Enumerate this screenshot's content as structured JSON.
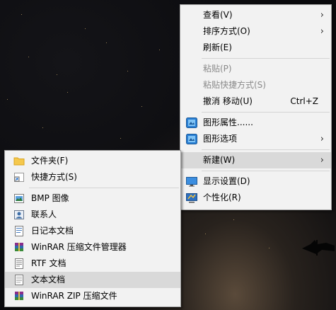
{
  "context_menu": {
    "items": [
      {
        "label": "查看(V)",
        "submenu": true
      },
      {
        "label": "排序方式(O)",
        "submenu": true
      },
      {
        "label": "刷新(E)"
      },
      {
        "label": "粘贴(P)",
        "disabled": true
      },
      {
        "label": "粘贴快捷方式(S)",
        "disabled": true
      },
      {
        "label": "撤消 移动(U)",
        "shortcut": "Ctrl+Z"
      },
      {
        "label": "图形属性......",
        "icon": "graphics-icon"
      },
      {
        "label": "图形选项",
        "icon": "graphics-icon",
        "submenu": true
      },
      {
        "label": "新建(W)",
        "submenu": true,
        "highlighted": true
      },
      {
        "label": "显示设置(D)",
        "icon": "display-icon"
      },
      {
        "label": "个性化(R)",
        "icon": "personalize-icon"
      }
    ]
  },
  "new_submenu": {
    "items": [
      {
        "label": "文件夹(F)",
        "icon": "folder-icon"
      },
      {
        "label": "快捷方式(S)",
        "icon": "shortcut-icon"
      },
      {
        "label": "BMP 图像",
        "icon": "bmp-icon"
      },
      {
        "label": "联系人",
        "icon": "contact-icon"
      },
      {
        "label": "日记本文档",
        "icon": "journal-icon"
      },
      {
        "label": "WinRAR 压缩文件管理器",
        "icon": "winrar-icon"
      },
      {
        "label": "RTF 文档",
        "icon": "rtf-icon"
      },
      {
        "label": "文本文档",
        "icon": "text-document-icon",
        "highlighted": true
      },
      {
        "label": "WinRAR ZIP 压缩文件",
        "icon": "winrar-zip-icon"
      }
    ]
  }
}
